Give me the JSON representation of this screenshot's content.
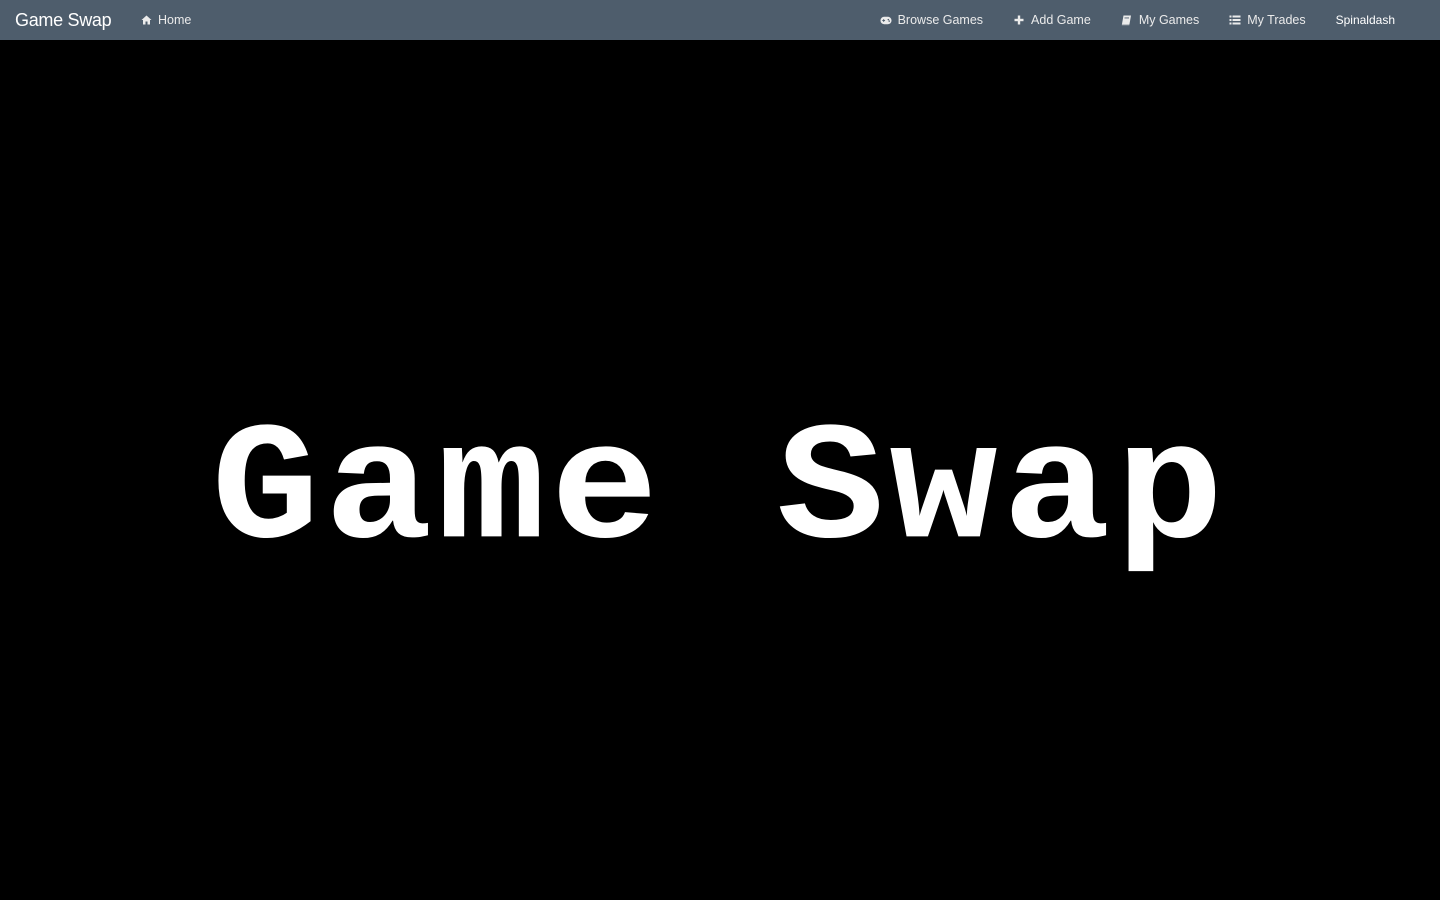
{
  "navbar": {
    "brand": "Game Swap",
    "left_items": [
      {
        "label": "Home",
        "icon": "home-icon"
      }
    ],
    "right_items": [
      {
        "label": "Browse Games",
        "icon": "gamepad-icon"
      },
      {
        "label": "Add Game",
        "icon": "plus-icon"
      },
      {
        "label": "My Games",
        "icon": "book-icon"
      },
      {
        "label": "My Trades",
        "icon": "list-icon"
      }
    ],
    "user": "Spinaldash"
  },
  "hero": {
    "title": "Game Swap"
  },
  "colors": {
    "navbar_bg": "#4e5d6c",
    "page_bg": "#000000",
    "text": "#ffffff"
  }
}
